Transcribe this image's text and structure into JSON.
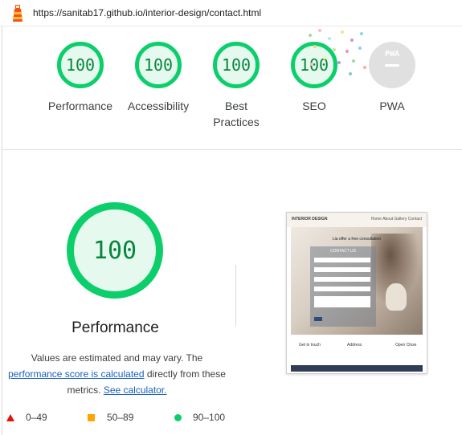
{
  "browser": {
    "url": "https://sanitab17.github.io/interior-design/contact.html"
  },
  "categories": [
    {
      "label": "Performance",
      "score": "100"
    },
    {
      "label": "Accessibility",
      "score": "100"
    },
    {
      "label": "Best Practices",
      "score": "100"
    },
    {
      "label": "SEO",
      "score": "100"
    },
    {
      "label": "PWA",
      "score": "",
      "badge": "PWA"
    }
  ],
  "main": {
    "score": "100",
    "title": "Performance",
    "note_prefix": "Values are estimated and may vary. The",
    "note_link": "performance score is calculated",
    "note_mid": "directly from these metrics.",
    "note_link2": "See calculator."
  },
  "legend": [
    {
      "range": "0–49",
      "color": "#eb0f00"
    },
    {
      "range": "50–89",
      "color": "#ffa400"
    },
    {
      "range": "90–100",
      "color": "#0cce6b"
    }
  ],
  "thumbnail": {
    "logo": "INTERIOR DESIGN",
    "nav": "Home About Gallery Contact",
    "headline": "Lia offer a free consultation",
    "form_title": "CONTACT US",
    "footer_left": "Get in touch",
    "footer_mid": "Address",
    "footer_right": "Open Close"
  },
  "colors": {
    "pass": "#0cce6b",
    "pass_text": "#08863f",
    "link": "#1a5fbf"
  }
}
